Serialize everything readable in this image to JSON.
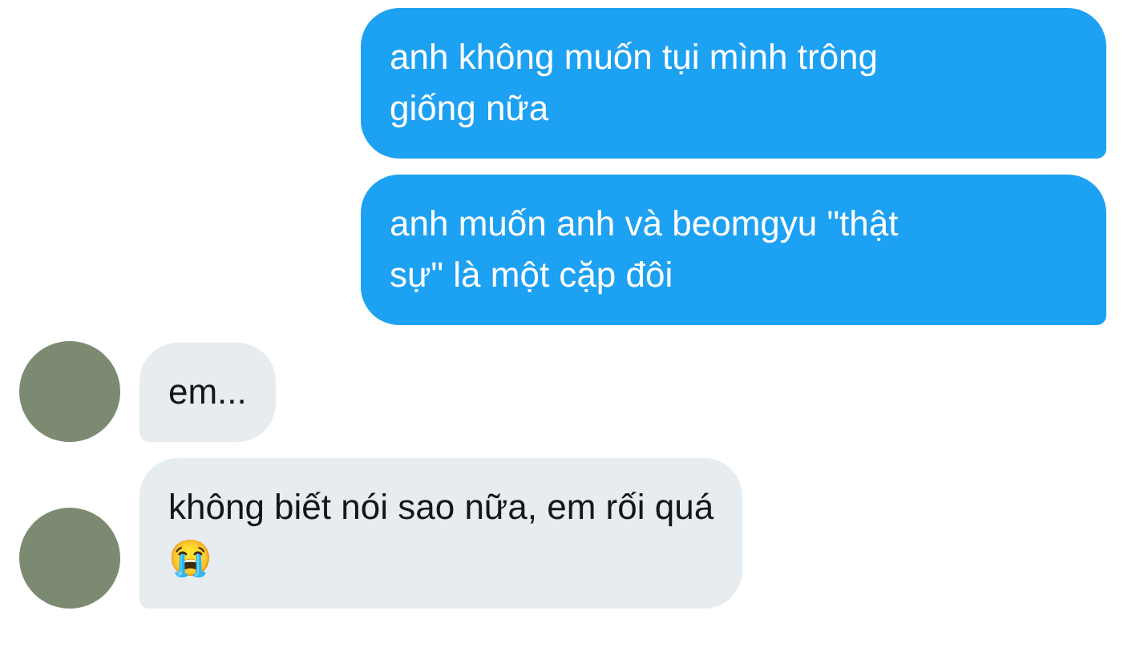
{
  "messages": [
    {
      "kind": "sent",
      "text": "anh không muốn tụi mình trông\ngiống nữa"
    },
    {
      "kind": "sent",
      "text": "anh muốn anh và beomgyu \"thật\nsự\" là một cặp đôi"
    },
    {
      "kind": "received",
      "text": "em..."
    },
    {
      "kind": "received",
      "text": "không biết nói sao nữa, em rối quá\n😭"
    }
  ]
}
